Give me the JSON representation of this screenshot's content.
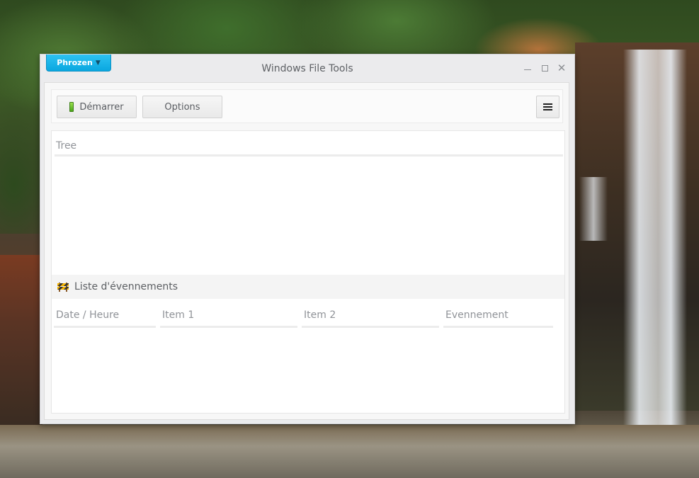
{
  "brand_menu": {
    "label": "Phrozen",
    "caret": "▼"
  },
  "window": {
    "title": "Windows File Tools",
    "controls": {
      "minimize": "minimize",
      "maximize": "maximize",
      "close": "✕"
    }
  },
  "toolbar": {
    "start_label": "Démarrer",
    "options_label": "Options"
  },
  "tree": {
    "header": "Tree"
  },
  "events": {
    "title": "Liste d'évennements",
    "columns": [
      "Date / Heure",
      "Item 1",
      "Item 2",
      "Evennement"
    ]
  },
  "icons": {
    "start": "battery-icon",
    "menu": "hamburger-icon",
    "events": "barrier-icon"
  },
  "colors": {
    "brand_accent": "#0aa7e0",
    "start_icon": "#4aa61a"
  }
}
